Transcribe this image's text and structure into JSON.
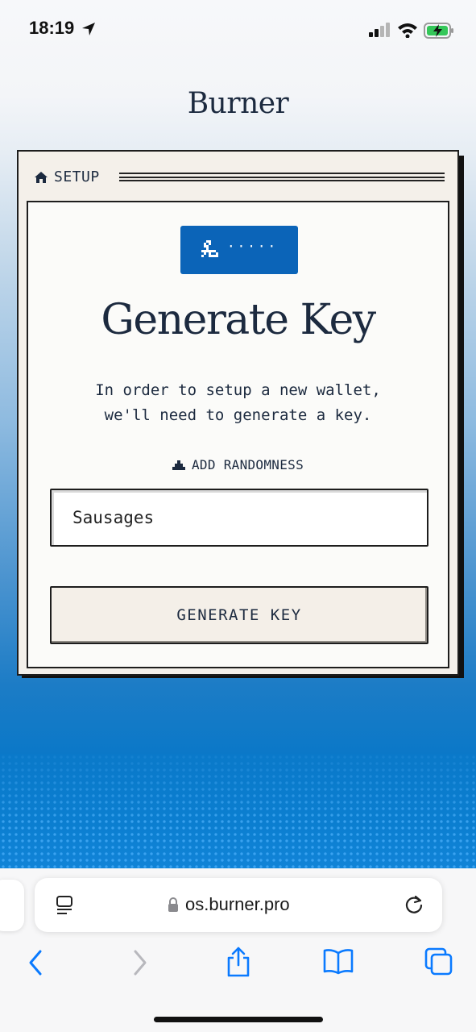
{
  "status_bar": {
    "time": "18:19",
    "icons": [
      "location-arrow-icon",
      "cellular-signal-icon",
      "wifi-icon",
      "battery-charging-icon"
    ]
  },
  "app": {
    "brand": "Burner"
  },
  "card": {
    "header_label": "SETUP",
    "header_icon": "home-icon",
    "badge": {
      "icon": "key-pixel-icon",
      "dots": "·····",
      "color": "#0b64b8"
    },
    "title": "Generate Key",
    "description_line1": "In order to setup a new wallet,",
    "description_line2": "we'll need to generate a key.",
    "randomness_label": "ADD RANDOMNESS",
    "randomness_icon": "shovel-icon",
    "randomness_value": "Sausages",
    "button_label": "GENERATE KEY"
  },
  "browser": {
    "url": "os.burner.pro",
    "icons": [
      "reader-icon",
      "lock-icon",
      "reload-icon"
    ],
    "toolbar_icons": [
      "back-icon",
      "forward-icon",
      "share-icon",
      "bookmarks-icon",
      "tabs-icon"
    ],
    "accent": "#0a7aff"
  }
}
